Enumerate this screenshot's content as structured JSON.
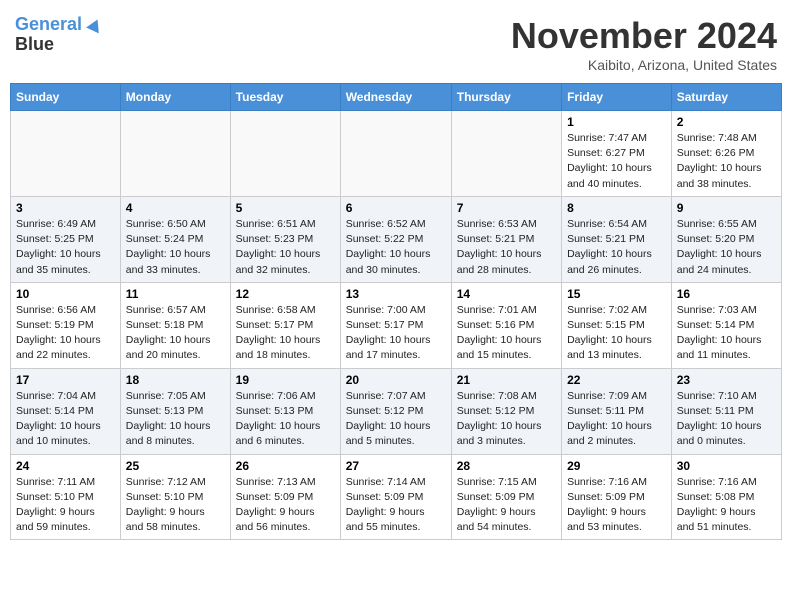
{
  "header": {
    "logo_line1": "General",
    "logo_line2": "Blue",
    "month": "November 2024",
    "location": "Kaibito, Arizona, United States"
  },
  "weekdays": [
    "Sunday",
    "Monday",
    "Tuesday",
    "Wednesday",
    "Thursday",
    "Friday",
    "Saturday"
  ],
  "weeks": [
    [
      {
        "day": "",
        "info": ""
      },
      {
        "day": "",
        "info": ""
      },
      {
        "day": "",
        "info": ""
      },
      {
        "day": "",
        "info": ""
      },
      {
        "day": "",
        "info": ""
      },
      {
        "day": "1",
        "info": "Sunrise: 7:47 AM\nSunset: 6:27 PM\nDaylight: 10 hours\nand 40 minutes."
      },
      {
        "day": "2",
        "info": "Sunrise: 7:48 AM\nSunset: 6:26 PM\nDaylight: 10 hours\nand 38 minutes."
      }
    ],
    [
      {
        "day": "3",
        "info": "Sunrise: 6:49 AM\nSunset: 5:25 PM\nDaylight: 10 hours\nand 35 minutes."
      },
      {
        "day": "4",
        "info": "Sunrise: 6:50 AM\nSunset: 5:24 PM\nDaylight: 10 hours\nand 33 minutes."
      },
      {
        "day": "5",
        "info": "Sunrise: 6:51 AM\nSunset: 5:23 PM\nDaylight: 10 hours\nand 32 minutes."
      },
      {
        "day": "6",
        "info": "Sunrise: 6:52 AM\nSunset: 5:22 PM\nDaylight: 10 hours\nand 30 minutes."
      },
      {
        "day": "7",
        "info": "Sunrise: 6:53 AM\nSunset: 5:21 PM\nDaylight: 10 hours\nand 28 minutes."
      },
      {
        "day": "8",
        "info": "Sunrise: 6:54 AM\nSunset: 5:21 PM\nDaylight: 10 hours\nand 26 minutes."
      },
      {
        "day": "9",
        "info": "Sunrise: 6:55 AM\nSunset: 5:20 PM\nDaylight: 10 hours\nand 24 minutes."
      }
    ],
    [
      {
        "day": "10",
        "info": "Sunrise: 6:56 AM\nSunset: 5:19 PM\nDaylight: 10 hours\nand 22 minutes."
      },
      {
        "day": "11",
        "info": "Sunrise: 6:57 AM\nSunset: 5:18 PM\nDaylight: 10 hours\nand 20 minutes."
      },
      {
        "day": "12",
        "info": "Sunrise: 6:58 AM\nSunset: 5:17 PM\nDaylight: 10 hours\nand 18 minutes."
      },
      {
        "day": "13",
        "info": "Sunrise: 7:00 AM\nSunset: 5:17 PM\nDaylight: 10 hours\nand 17 minutes."
      },
      {
        "day": "14",
        "info": "Sunrise: 7:01 AM\nSunset: 5:16 PM\nDaylight: 10 hours\nand 15 minutes."
      },
      {
        "day": "15",
        "info": "Sunrise: 7:02 AM\nSunset: 5:15 PM\nDaylight: 10 hours\nand 13 minutes."
      },
      {
        "day": "16",
        "info": "Sunrise: 7:03 AM\nSunset: 5:14 PM\nDaylight: 10 hours\nand 11 minutes."
      }
    ],
    [
      {
        "day": "17",
        "info": "Sunrise: 7:04 AM\nSunset: 5:14 PM\nDaylight: 10 hours\nand 10 minutes."
      },
      {
        "day": "18",
        "info": "Sunrise: 7:05 AM\nSunset: 5:13 PM\nDaylight: 10 hours\nand 8 minutes."
      },
      {
        "day": "19",
        "info": "Sunrise: 7:06 AM\nSunset: 5:13 PM\nDaylight: 10 hours\nand 6 minutes."
      },
      {
        "day": "20",
        "info": "Sunrise: 7:07 AM\nSunset: 5:12 PM\nDaylight: 10 hours\nand 5 minutes."
      },
      {
        "day": "21",
        "info": "Sunrise: 7:08 AM\nSunset: 5:12 PM\nDaylight: 10 hours\nand 3 minutes."
      },
      {
        "day": "22",
        "info": "Sunrise: 7:09 AM\nSunset: 5:11 PM\nDaylight: 10 hours\nand 2 minutes."
      },
      {
        "day": "23",
        "info": "Sunrise: 7:10 AM\nSunset: 5:11 PM\nDaylight: 10 hours\nand 0 minutes."
      }
    ],
    [
      {
        "day": "24",
        "info": "Sunrise: 7:11 AM\nSunset: 5:10 PM\nDaylight: 9 hours\nand 59 minutes."
      },
      {
        "day": "25",
        "info": "Sunrise: 7:12 AM\nSunset: 5:10 PM\nDaylight: 9 hours\nand 58 minutes."
      },
      {
        "day": "26",
        "info": "Sunrise: 7:13 AM\nSunset: 5:09 PM\nDaylight: 9 hours\nand 56 minutes."
      },
      {
        "day": "27",
        "info": "Sunrise: 7:14 AM\nSunset: 5:09 PM\nDaylight: 9 hours\nand 55 minutes."
      },
      {
        "day": "28",
        "info": "Sunrise: 7:15 AM\nSunset: 5:09 PM\nDaylight: 9 hours\nand 54 minutes."
      },
      {
        "day": "29",
        "info": "Sunrise: 7:16 AM\nSunset: 5:09 PM\nDaylight: 9 hours\nand 53 minutes."
      },
      {
        "day": "30",
        "info": "Sunrise: 7:16 AM\nSunset: 5:08 PM\nDaylight: 9 hours\nand 51 minutes."
      }
    ]
  ]
}
